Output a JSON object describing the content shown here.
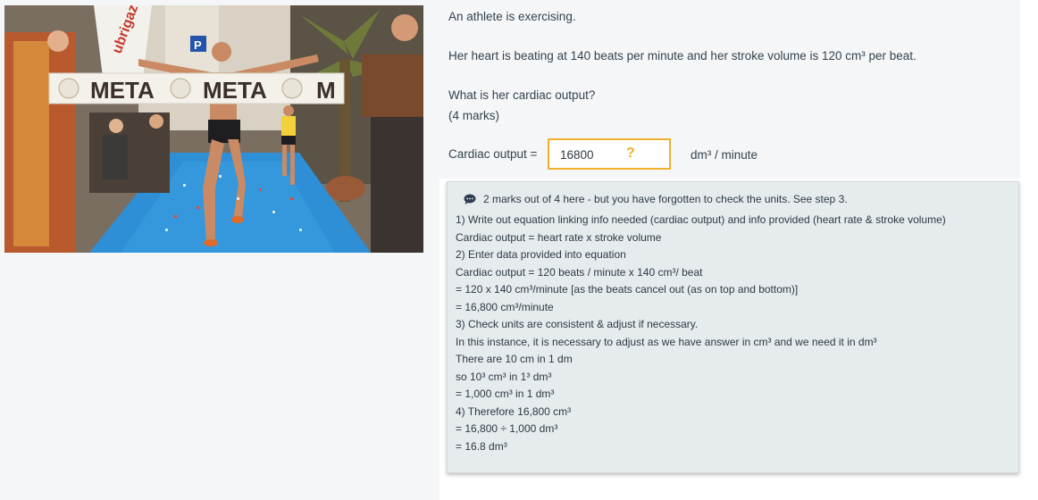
{
  "photo": {
    "banner_texts": [
      "META",
      "META",
      "M"
    ],
    "sign_letter": "P",
    "vertical_text": "ubrigaz"
  },
  "question": {
    "line1": "An athlete is exercising.",
    "line2": "Her heart is beating at 140 beats per minute and her stroke volume is 120 cm³ per beat.",
    "line3": "What is her cardiac output?",
    "marks": "(4 marks)",
    "answer_label": "Cardiac output =",
    "answer_value": "16800",
    "answer_hint_icon": "?",
    "units": "dm³ / minute"
  },
  "feedback": {
    "icon": "speech-bubble-icon",
    "header": "2 marks out of 4 here - but you have forgotten to check the units. See step 3.",
    "lines": [
      "1) Write out equation linking info needed (cardiac output) and info provided (heart rate & stroke volume)",
      "Cardiac output = heart rate x stroke volume",
      "2) Enter data provided into equation",
      "Cardiac output = 120 beats / minute x 140 cm³/ beat",
      "= 120 x 140 cm³/minute [as the beats cancel out (as on top and bottom)]",
      "= 16,800 cm³/minute",
      "3) Check units are consistent & adjust if necessary.",
      "In this instance, it is necessary to adjust as we have answer in cm³ and we need it in dm³",
      "There are 10 cm in 1 dm",
      "so 10³ cm³ in 1³ dm³",
      "= 1,000 cm³ in 1 dm³",
      "4) Therefore 16,800 cm³",
      "= 16,800 ÷ 1,000 dm³",
      "= 16.8 dm³"
    ]
  },
  "colors": {
    "answer_border": "#f0b02c",
    "feedback_bg": "#e6ebee",
    "panel_bg": "#f5f6f8",
    "track_blue": "#2f8fd6"
  }
}
